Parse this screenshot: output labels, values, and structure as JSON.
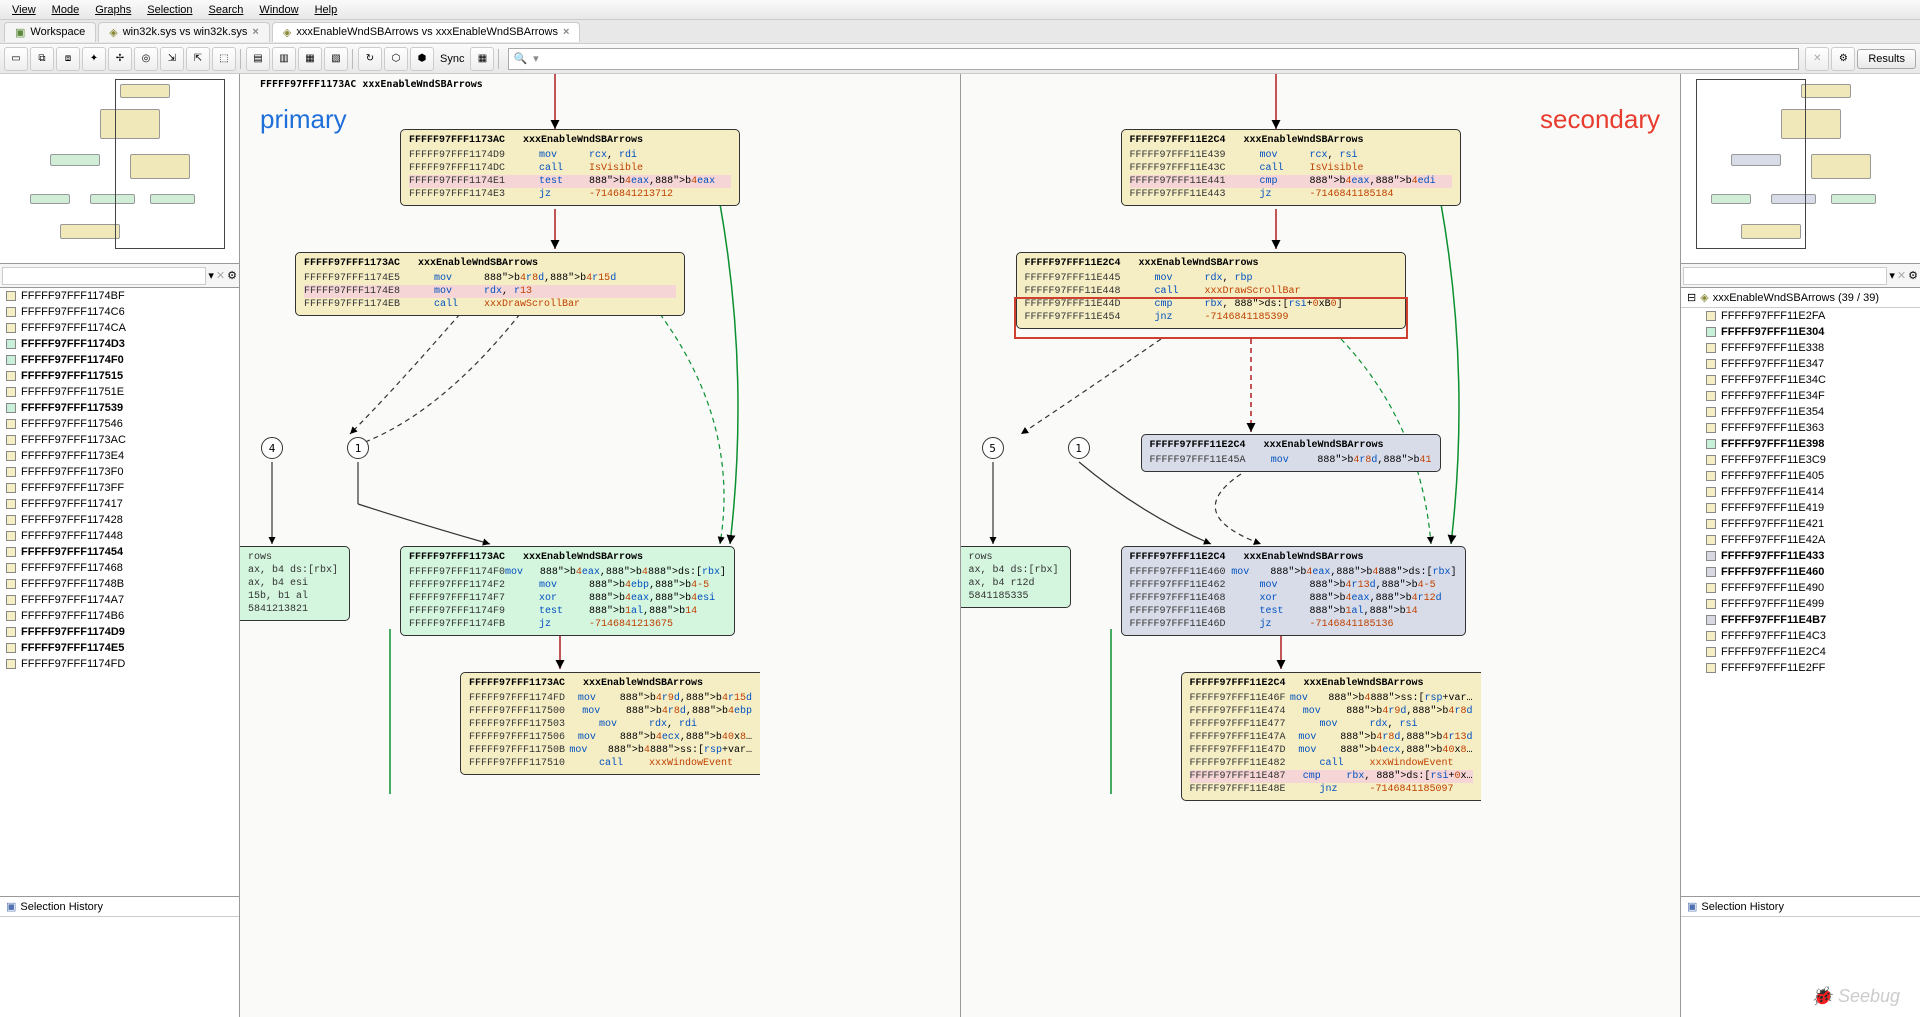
{
  "menubar": [
    "View",
    "Mode",
    "Graphs",
    "Selection",
    "Search",
    "Window",
    "Help"
  ],
  "tabs": [
    {
      "label": "Workspace",
      "icon": "workspace",
      "closable": false
    },
    {
      "label": "win32k.sys vs win32k.sys",
      "icon": "diff",
      "closable": true
    },
    {
      "label": "xxxEnableWndSBArrows vs xxxEnableWndSBArrows",
      "icon": "diff",
      "closable": true,
      "active": true
    }
  ],
  "sync_label": "Sync",
  "results_label": "Results",
  "search_placeholder": "",
  "search_icon_text": "",
  "primary_label": "primary",
  "secondary_label": "secondary",
  "graph_title_primary": "FFFFF97FFF1173AC xxxEnableWndSBArrows",
  "tree_right": "xxxEnableWndSBArrows (39 / 39)",
  "selection_history": "Selection History",
  "watermark": "Seebug",
  "left_addresses": [
    {
      "a": "FFFFF97FFF1174BF",
      "c": "yellow"
    },
    {
      "a": "FFFFF97FFF1174C6",
      "c": "yellow"
    },
    {
      "a": "FFFFF97FFF1174CA",
      "c": "yellow"
    },
    {
      "a": "FFFFF97FFF1174D3",
      "c": "green",
      "bold": true
    },
    {
      "a": "FFFFF97FFF1174F0",
      "c": "green",
      "bold": true
    },
    {
      "a": "FFFFF97FFF117515",
      "c": "yellow",
      "bold": true
    },
    {
      "a": "FFFFF97FFF11751E",
      "c": "yellow"
    },
    {
      "a": "FFFFF97FFF117539",
      "c": "green",
      "bold": true
    },
    {
      "a": "FFFFF97FFF117546",
      "c": "yellow"
    },
    {
      "a": "FFFFF97FFF1173AC",
      "c": "yellow"
    },
    {
      "a": "FFFFF97FFF1173E4",
      "c": "yellow"
    },
    {
      "a": "FFFFF97FFF1173F0",
      "c": "yellow"
    },
    {
      "a": "FFFFF97FFF1173FF",
      "c": "yellow"
    },
    {
      "a": "FFFFF97FFF117417",
      "c": "yellow"
    },
    {
      "a": "FFFFF97FFF117428",
      "c": "yellow"
    },
    {
      "a": "FFFFF97FFF117448",
      "c": "yellow"
    },
    {
      "a": "FFFFF97FFF117454",
      "c": "yellow",
      "bold": true
    },
    {
      "a": "FFFFF97FFF117468",
      "c": "yellow"
    },
    {
      "a": "FFFFF97FFF11748B",
      "c": "yellow"
    },
    {
      "a": "FFFFF97FFF1174A7",
      "c": "yellow"
    },
    {
      "a": "FFFFF97FFF1174B6",
      "c": "yellow"
    },
    {
      "a": "FFFFF97FFF1174D9",
      "c": "yellow",
      "bold": true
    },
    {
      "a": "FFFFF97FFF1174E5",
      "c": "yellow",
      "bold": true
    },
    {
      "a": "FFFFF97FFF1174FD",
      "c": "yellow"
    }
  ],
  "right_addresses": [
    {
      "a": "FFFFF97FFF11E2FA",
      "c": "yellow"
    },
    {
      "a": "FFFFF97FFF11E304",
      "c": "green",
      "bold": true
    },
    {
      "a": "FFFFF97FFF11E338",
      "c": "yellow"
    },
    {
      "a": "FFFFF97FFF11E347",
      "c": "yellow"
    },
    {
      "a": "FFFFF97FFF11E34C",
      "c": "yellow"
    },
    {
      "a": "FFFFF97FFF11E34F",
      "c": "yellow"
    },
    {
      "a": "FFFFF97FFF11E354",
      "c": "yellow"
    },
    {
      "a": "FFFFF97FFF11E363",
      "c": "yellow"
    },
    {
      "a": "FFFFF97FFF11E398",
      "c": "green",
      "bold": true
    },
    {
      "a": "FFFFF97FFF11E3C9",
      "c": "yellow"
    },
    {
      "a": "FFFFF97FFF11E405",
      "c": "yellow"
    },
    {
      "a": "FFFFF97FFF11E414",
      "c": "yellow"
    },
    {
      "a": "FFFFF97FFF11E419",
      "c": "yellow"
    },
    {
      "a": "FFFFF97FFF11E421",
      "c": "yellow"
    },
    {
      "a": "FFFFF97FFF11E42A",
      "c": "yellow"
    },
    {
      "a": "FFFFF97FFF11E433",
      "c": "gray",
      "bold": true
    },
    {
      "a": "FFFFF97FFF11E460",
      "c": "gray",
      "bold": true
    },
    {
      "a": "FFFFF97FFF11E490",
      "c": "yellow"
    },
    {
      "a": "FFFFF97FFF11E499",
      "c": "yellow"
    },
    {
      "a": "FFFFF97FFF11E4B7",
      "c": "gray",
      "bold": true
    },
    {
      "a": "FFFFF97FFF11E4C3",
      "c": "yellow"
    },
    {
      "a": "FFFFF97FFF11E2C4",
      "c": "yellow"
    },
    {
      "a": "FFFFF97FFF11E2FF",
      "c": "yellow"
    }
  ],
  "p_block1": {
    "hdr": "FFFFF97FFF1173AC   xxxEnableWndSBArrows",
    "rows": [
      {
        "a": "FFFFF97FFF1174D9",
        "op": "mov",
        "arg": "rcx, rdi"
      },
      {
        "a": "FFFFF97FFF1174DC",
        "op": "call",
        "arg": "IsVisible",
        "fn": true
      },
      {
        "a": "FFFFF97FFF1174E1",
        "op": "test",
        "arg": "b4 eax, b4 eax",
        "pink": true
      },
      {
        "a": "",
        "op": "",
        "arg": ""
      },
      {
        "a": "FFFFF97FFF1174E3",
        "op": "jz",
        "arg": "-7146841213712",
        "fn": true
      }
    ]
  },
  "p_block2": {
    "hdr": "FFFFF97FFF1173AC   xxxEnableWndSBArrows",
    "rows": [
      {
        "a": "FFFFF97FFF1174E5",
        "op": "mov",
        "arg": "b4 r8d, b4 r15d"
      },
      {
        "a": "FFFFF97FFF1174E8",
        "op": "mov",
        "arg": "rdx, r13",
        "pink": true
      },
      {
        "a": "FFFFF97FFF1174EB",
        "op": "call",
        "arg": "xxxDrawScrollBar",
        "fn": true
      }
    ]
  },
  "p_block3": {
    "hdr": "FFFFF97FFF1173AC   xxxEnableWndSBArrows",
    "rows": [
      {
        "a": "FFFFF97FFF1174F0",
        "op": "mov",
        "arg": "b4 eax, b4 ds:[rbx]"
      },
      {
        "a": "FFFFF97FFF1174F2",
        "op": "mov",
        "arg": "b4 ebp, b4 -5"
      },
      {
        "a": "FFFFF97FFF1174F7",
        "op": "xor",
        "arg": "b4 eax, b4 esi"
      },
      {
        "a": "FFFFF97FFF1174F9",
        "op": "test",
        "arg": "b1 al, b1 4"
      },
      {
        "a": "FFFFF97FFF1174FB",
        "op": "jz",
        "arg": "-7146841213675",
        "fn": true
      }
    ]
  },
  "p_block4": {
    "hdr": "FFFFF97FFF1173AC   xxxEnableWndSBArrows",
    "rows": [
      {
        "a": "FFFFF97FFF1174FD",
        "op": "mov",
        "arg": "b4 r9d, b4 r15d"
      },
      {
        "a": "FFFFF97FFF117500",
        "op": "mov",
        "arg": "b4 r8d, b4 ebp"
      },
      {
        "a": "FFFFF97FFF117503",
        "op": "mov",
        "arg": "rdx, rdi"
      },
      {
        "a": "FFFFF97FFF117506",
        "op": "mov",
        "arg": "b4 ecx, b4 0x8…"
      },
      {
        "a": "FFFFF97FFF11750B",
        "op": "mov",
        "arg": "b4 ss:[rsp+var…"
      },
      {
        "a": "FFFFF97FFF117510",
        "op": "call",
        "arg": "xxxWindowEvent",
        "fn": true
      }
    ]
  },
  "p_partial": {
    "rows": [
      {
        "a": "rows",
        "op": "",
        "arg": ""
      },
      {
        "a": "ax, b4 ds:[rbx]",
        "op": "",
        "arg": ""
      },
      {
        "a": "ax, b4 esi",
        "op": "",
        "arg": ""
      },
      {
        "a": "15b, b1 al",
        "op": "",
        "arg": ""
      },
      {
        "a": "5841213821",
        "op": "",
        "arg": "",
        "fn": true
      }
    ]
  },
  "s_block1": {
    "hdr": "FFFFF97FFF11E2C4   xxxEnableWndSBArrows",
    "rows": [
      {
        "a": "FFFFF97FFF11E439",
        "op": "mov",
        "arg": "rcx, rsi"
      },
      {
        "a": "FFFFF97FFF11E43C",
        "op": "call",
        "arg": "IsVisible",
        "fn": true
      },
      {
        "a": "",
        "op": "",
        "arg": ""
      },
      {
        "a": "FFFFF97FFF11E441",
        "op": "cmp",
        "arg": "b4 eax, b4 edi",
        "pink": true
      },
      {
        "a": "FFFFF97FFF11E443",
        "op": "jz",
        "arg": "-7146841185184",
        "fn": true
      }
    ]
  },
  "s_block2": {
    "hdr": "FFFFF97FFF11E2C4   xxxEnableWndSBArrows",
    "rows": [
      {
        "a": "FFFFF97FFF11E445",
        "op": "mov",
        "arg": "rdx, rbp"
      },
      {
        "a": "",
        "op": "",
        "arg": ""
      },
      {
        "a": "FFFFF97FFF11E448",
        "op": "call",
        "arg": "xxxDrawScrollBar",
        "fn": true,
        "strike": true
      },
      {
        "a": "FFFFF97FFF11E44D",
        "op": "cmp",
        "arg": "rbx, ds:[rsi+0xB0]",
        "red": true
      },
      {
        "a": "FFFFF97FFF11E454",
        "op": "jnz",
        "arg": "-7146841185399",
        "fn": true,
        "red": true
      }
    ]
  },
  "s_block2b": {
    "hdr": "FFFFF97FFF11E2C4   xxxEnableWndSBArrows",
    "rows": [
      {
        "a": "FFFFF97FFF11E45A",
        "op": "mov",
        "arg": "b4 r8d, b4 1"
      }
    ]
  },
  "s_block3": {
    "hdr": "FFFFF97FFF11E2C4   xxxEnableWndSBArrows",
    "rows": [
      {
        "a": "FFFFF97FFF11E460",
        "op": "mov",
        "arg": "b4 eax, b4 ds:[rbx]"
      },
      {
        "a": "FFFFF97FFF11E462",
        "op": "mov",
        "arg": "b4 r13d, b4 -5"
      },
      {
        "a": "FFFFF97FFF11E468",
        "op": "xor",
        "arg": "b4 eax, b4 r12d"
      },
      {
        "a": "FFFFF97FFF11E46B",
        "op": "test",
        "arg": "b1 al, b1 4"
      },
      {
        "a": "FFFFF97FFF11E46D",
        "op": "jz",
        "arg": "-7146841185136",
        "fn": true
      }
    ]
  },
  "s_block4": {
    "hdr": "FFFFF97FFF11E2C4   xxxEnableWndSBArrows",
    "rows": [
      {
        "a": "FFFFF97FFF11E46F",
        "op": "mov",
        "arg": "b4 ss:[rsp+var…"
      },
      {
        "a": "FFFFF97FFF11E474",
        "op": "mov",
        "arg": "b4 r9d, b4 r8d"
      },
      {
        "a": "FFFFF97FFF11E477",
        "op": "mov",
        "arg": "rdx, rsi"
      },
      {
        "a": "FFFFF97FFF11E47A",
        "op": "mov",
        "arg": "b4 r8d, b4 r13d"
      },
      {
        "a": "FFFFF97FFF11E47D",
        "op": "mov",
        "arg": "b4 ecx, b4 0x8…"
      },
      {
        "a": "FFFFF97FFF11E482",
        "op": "call",
        "arg": "xxxWindowEvent",
        "fn": true
      },
      {
        "a": "FFFFF97FFF11E487",
        "op": "cmp",
        "arg": "rbx, ds:[rsi+0x…",
        "pink": true
      },
      {
        "a": "FFFFF97FFF11E48E",
        "op": "jnz",
        "arg": "-7146841185097",
        "fn": true
      }
    ]
  },
  "s_partial": {
    "rows": [
      {
        "a": "rows",
        "op": "",
        "arg": ""
      },
      {
        "a": "ax, b4 ds:[rbx]",
        "op": "",
        "arg": ""
      },
      {
        "a": "ax, b4 r12d",
        "op": "",
        "arg": ""
      },
      {
        "a": "5841185335",
        "op": "",
        "arg": "",
        "fn": true
      }
    ]
  },
  "circles_p": [
    "4",
    "1"
  ],
  "circles_s": [
    "5",
    "1"
  ]
}
